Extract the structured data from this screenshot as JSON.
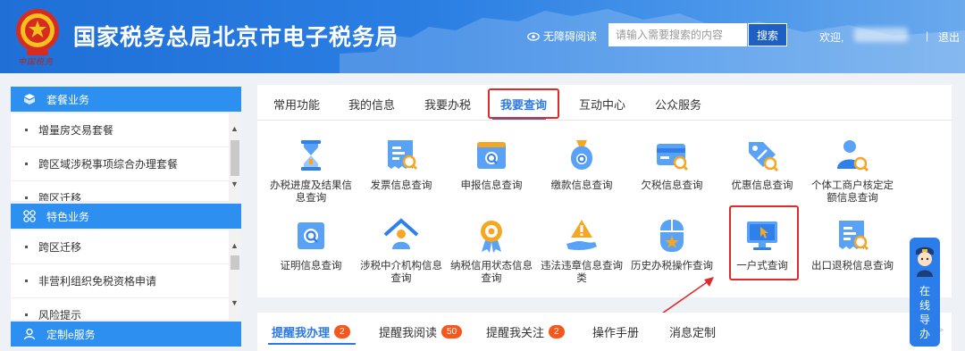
{
  "header": {
    "title": "国家税务总局北京市电子税务局",
    "emblem_caption": "中国税务",
    "accessibility": "无障碍阅读",
    "search_placeholder": "请输入需要搜索的内容",
    "search_button": "搜索",
    "welcome": "欢迎,",
    "separator": "|",
    "logout": "退出"
  },
  "sidebar": [
    {
      "title": "套餐业务",
      "icon": "cube-icon",
      "items": [
        "增量房交易套餐",
        "跨区域涉税事项综合办理套餐",
        "跨区迁移"
      ]
    },
    {
      "title": "特色业务",
      "icon": "grid-icon",
      "items": [
        "跨区迁移",
        "非营利组织免税资格申请",
        "风险提示"
      ]
    },
    {
      "title": "定制e服务",
      "icon": "user-icon"
    }
  ],
  "tabs": [
    "常用功能",
    "我的信息",
    "我要办税",
    "我要查询",
    "互动中心",
    "公众服务"
  ],
  "active_tab": "我要查询",
  "grid": [
    {
      "label": "办税进度及结果信息查询",
      "icon": "hourglass-icon"
    },
    {
      "label": "发票信息查询",
      "icon": "invoice-search-icon"
    },
    {
      "label": "申报信息查询",
      "icon": "declaration-search-icon"
    },
    {
      "label": "缴款信息查询",
      "icon": "money-bag-icon"
    },
    {
      "label": "欠税信息查询",
      "icon": "card-search-icon"
    },
    {
      "label": "优惠信息查询",
      "icon": "discount-tag-icon"
    },
    {
      "label": "个体工商户核定定额信息查询",
      "icon": "person-search-icon"
    },
    {
      "label": "证明信息查询",
      "icon": "certificate-search-icon"
    },
    {
      "label": "涉税中介机构信息查询",
      "icon": "agency-house-icon"
    },
    {
      "label": "纳税信用状态信息查询",
      "icon": "credit-medal-icon"
    },
    {
      "label": "违法违章信息查询类",
      "icon": "warning-hand-icon"
    },
    {
      "label": "历史办税操作查询",
      "icon": "mouse-history-icon"
    },
    {
      "label": "一户式查询",
      "icon": "monitor-cursor-icon"
    },
    {
      "label": "出口退税信息查询",
      "icon": "export-refund-icon"
    }
  ],
  "bottom_tabs": [
    {
      "label": "提醒我办理",
      "badge": "2"
    },
    {
      "label": "提醒我阅读",
      "badge": "50"
    },
    {
      "label": "提醒我关注",
      "badge": "2"
    },
    {
      "label": "操作手册",
      "badge": ""
    },
    {
      "label": "消息定制",
      "badge": ""
    }
  ],
  "more_arrow": ">>",
  "guide": {
    "text": "在线导办"
  },
  "colors": {
    "primary": "#2d7ae5",
    "header": "#2b7fe3",
    "highlight": "#e02a2a",
    "badge": "#f5581c"
  }
}
